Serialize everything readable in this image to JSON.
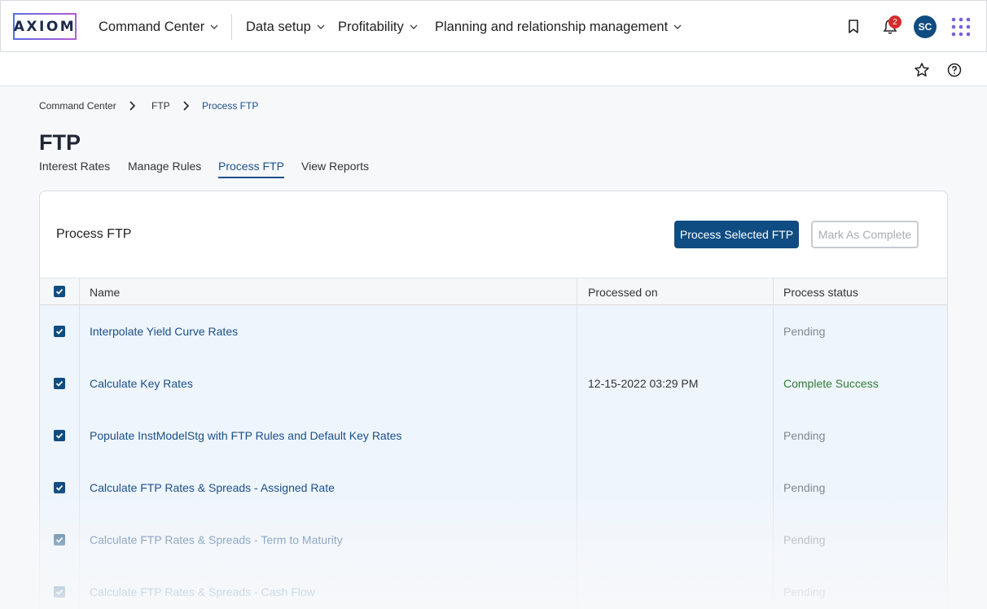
{
  "logo": {
    "text": "AXIOM"
  },
  "nav": {
    "items": [
      {
        "label": "Command Center"
      },
      {
        "label": "Data setup"
      },
      {
        "label": "Profitability"
      },
      {
        "label": "Planning and relationship management"
      }
    ],
    "notification_count": "2",
    "avatar_initials": "SC"
  },
  "breadcrumb": [
    "Command Center",
    "FTP",
    "Process FTP"
  ],
  "page": {
    "title": "FTP",
    "tabs": [
      {
        "label": "Interest Rates"
      },
      {
        "label": "Manage Rules"
      },
      {
        "label": "Process FTP",
        "active": true
      },
      {
        "label": "View Reports"
      }
    ]
  },
  "card": {
    "title": "Process FTP",
    "primary_button": "Process Selected FTP",
    "secondary_button": "Mark As Complete"
  },
  "table": {
    "headers": [
      "Name",
      "Processed on",
      "Process status"
    ],
    "rows": [
      {
        "name": "Interpolate Yield Curve Rates",
        "processed_on": "",
        "status": "Pending",
        "checked": true
      },
      {
        "name": "Calculate Key Rates",
        "processed_on": "12-15-2022 03:29 PM",
        "status": "Complete Success",
        "checked": true
      },
      {
        "name": "Populate InstModelStg with FTP Rules and Default Key Rates",
        "processed_on": "",
        "status": "Pending",
        "checked": true
      },
      {
        "name": "Calculate FTP Rates & Spreads - Assigned Rate",
        "processed_on": "",
        "status": "Pending",
        "checked": true
      },
      {
        "name": "Calculate FTP Rates & Spreads - Term to Maturity",
        "processed_on": "",
        "status": "Pending",
        "checked": true
      },
      {
        "name": "Calculate FTP Rates & Spreads - Cash Flow",
        "processed_on": "",
        "status": "Pending",
        "checked": true
      }
    ]
  },
  "colors": {
    "primary": "#0f4c81",
    "link": "#1b4f8a",
    "success": "#2f7d32",
    "pending": "#808890",
    "badge": "#d62b2b"
  },
  "icons": [
    "chevron-down-icon",
    "bookmark-icon",
    "bell-icon",
    "apps-grid-icon",
    "star-icon",
    "help-icon",
    "chevron-right-icon",
    "checkbox-checked-icon"
  ]
}
